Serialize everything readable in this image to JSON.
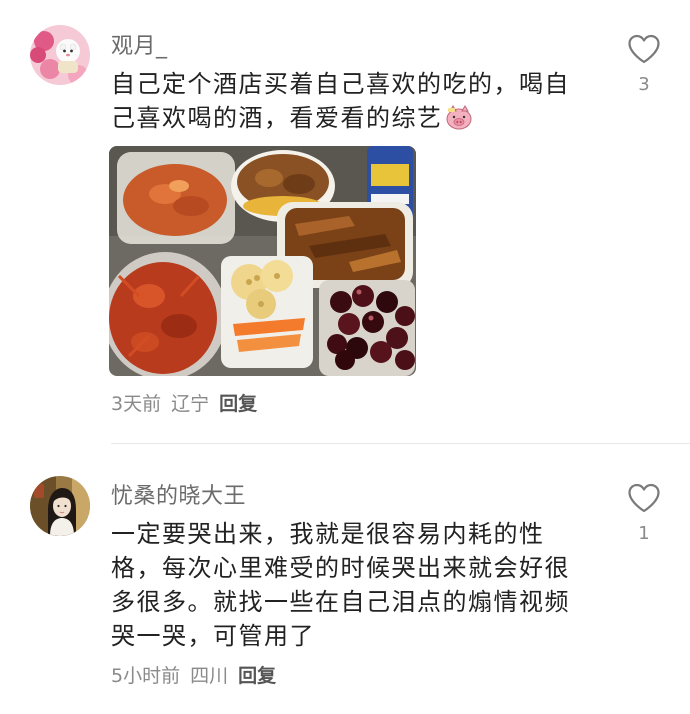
{
  "comments": [
    {
      "username": "观月_",
      "text": "自己定个酒店买着自己喜欢的吃的，喝自己喜欢喝的酒，看爱看的综艺",
      "emoji_icon": "pig-face-sticker",
      "likes": "3",
      "time": "3天前",
      "location": "辽宁",
      "reply_label": "回复",
      "has_photo": true
    },
    {
      "username": "忧桑的晓大王",
      "text": "一定要哭出来，我就是很容易内耗的性格，每次心里难受的时候哭出来就会好很多很多。就找一些在自己泪点的煽情视频哭一哭，可管用了",
      "likes": "1",
      "time": "5小时前",
      "location": "四川",
      "reply_label": "回复"
    }
  ],
  "colors": {
    "username": "#6b6b6b",
    "text": "#222222",
    "meta": "#8a8a8a",
    "divider": "#e8e8e8"
  }
}
